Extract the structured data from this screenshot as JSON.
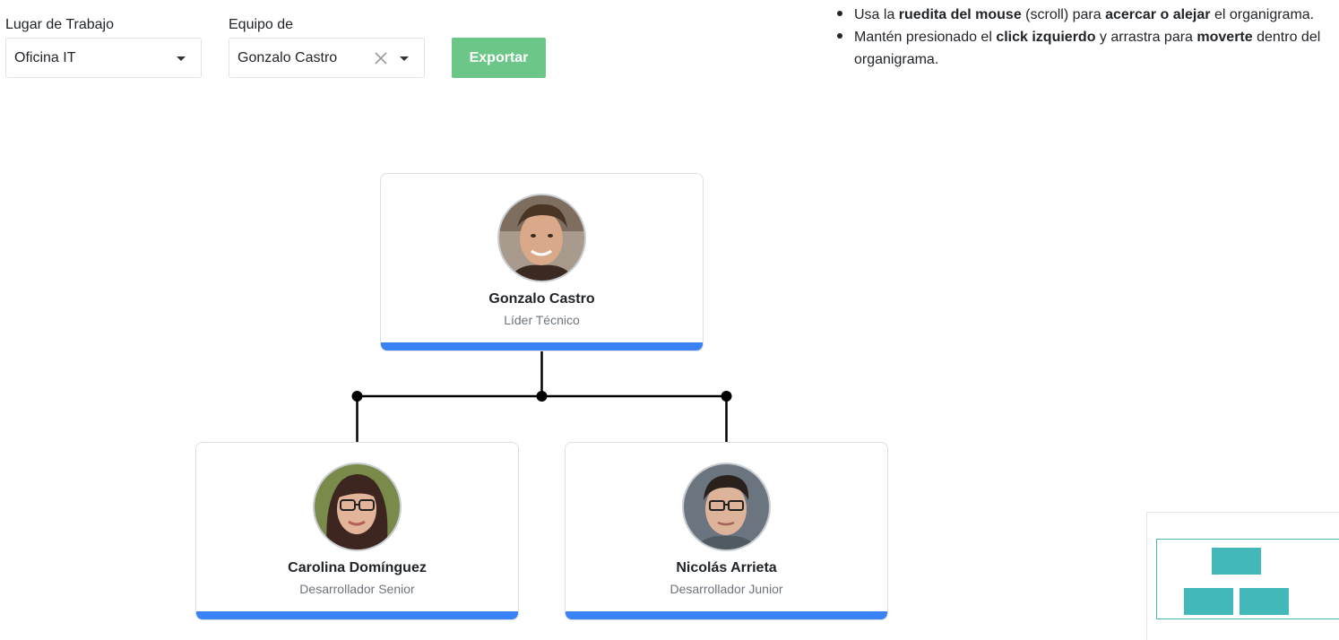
{
  "filters": {
    "workplace": {
      "label": "Lugar de Trabajo",
      "value": "Oficina IT"
    },
    "team": {
      "label": "Equipo de",
      "value": "Gonzalo Castro"
    },
    "export_label": "Exportar"
  },
  "instructions": [
    {
      "parts": [
        {
          "text": "Usa la ",
          "bold": false
        },
        {
          "text": "ruedita del mouse",
          "bold": true
        },
        {
          "text": " (scroll) para ",
          "bold": false
        },
        {
          "text": "acercar o alejar",
          "bold": true
        },
        {
          "text": " el organigrama.",
          "bold": false
        }
      ]
    },
    {
      "parts": [
        {
          "text": "Mantén presionado el ",
          "bold": false
        },
        {
          "text": "click izquierdo",
          "bold": true
        },
        {
          "text": " y arrastra para ",
          "bold": false
        },
        {
          "text": "moverte",
          "bold": true
        },
        {
          "text": " dentro del organigrama.",
          "bold": false
        }
      ]
    }
  ],
  "org": {
    "root": {
      "name": "Gonzalo Castro",
      "role": "Líder Técnico"
    },
    "children": [
      {
        "name": "Carolina Domínguez",
        "role": "Desarrollador Senior"
      },
      {
        "name": "Nicolás Arrieta",
        "role": "Desarrollador Junior"
      }
    ]
  },
  "colors": {
    "accent_bar": "#3b82f6",
    "export_button": "#6cc687",
    "minimap": "#43b8b8"
  }
}
